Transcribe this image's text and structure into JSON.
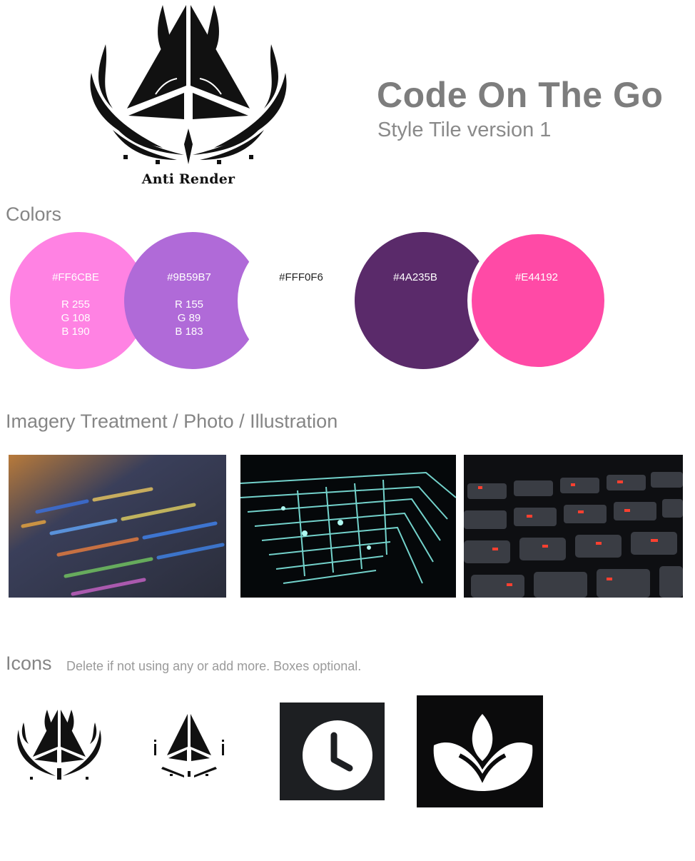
{
  "header": {
    "logo_text": "Anti Render",
    "title": "Code On The Go",
    "subtitle": "Style Tile version 1"
  },
  "colors": {
    "section_title": "Colors",
    "swatches": [
      {
        "hex": "#FF6CBE",
        "rgb": [
          "R 255",
          "G 108",
          "B 190"
        ],
        "fill": "#ff82e3"
      },
      {
        "hex": "#9B59B7",
        "rgb": [
          "R 155",
          "G 89",
          "B 183"
        ],
        "fill": "#b06ad8"
      },
      {
        "hex": "#FFF0F6",
        "rgb": [],
        "fill": "#ffffff"
      },
      {
        "hex": "#4A235B",
        "rgb": [],
        "fill": "#5a2a6a"
      },
      {
        "hex": "#E44192",
        "rgb": [],
        "fill": "#ff4aa6"
      }
    ]
  },
  "imagery": {
    "section_title": "Imagery Treatment / Photo / Illustration"
  },
  "icons": {
    "section_title": "Icons",
    "note": "Delete if not using any or add more. Boxes optional."
  }
}
